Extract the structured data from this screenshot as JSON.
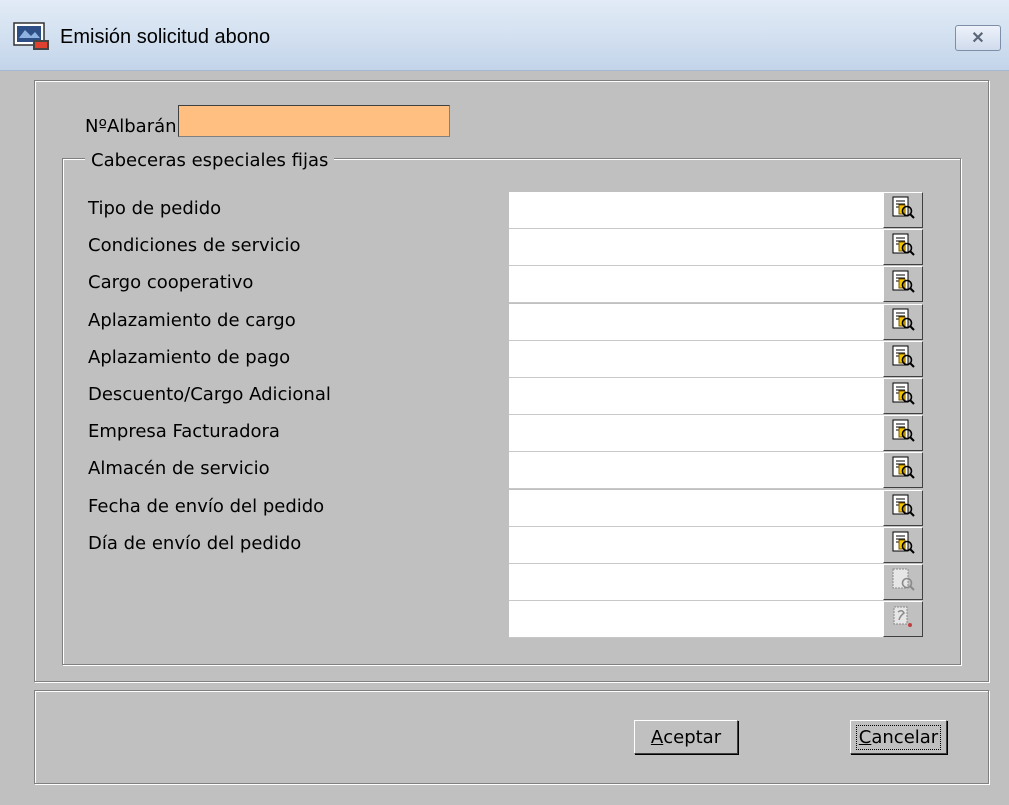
{
  "window": {
    "title": "Emisión solicitud abono",
    "close_glyph": "✕"
  },
  "albaran": {
    "label": "NºAlbarán",
    "value": "",
    "highlight_color": "#ffbf80"
  },
  "group": {
    "title": "Cabeceras especiales fijas",
    "rows": [
      {
        "label": "Tipo de pedido",
        "value": ""
      },
      {
        "label": "Condiciones de servicio",
        "value": ""
      },
      {
        "label": "Cargo cooperativo",
        "value": ""
      },
      {
        "label": "Aplazamiento de cargo",
        "value": ""
      },
      {
        "label": "Aplazamiento de pago",
        "value": ""
      },
      {
        "label": "Descuento/Cargo Adicional",
        "value": ""
      },
      {
        "label": "Empresa Facturadora",
        "value": ""
      },
      {
        "label": "Almacén de servicio",
        "value": ""
      },
      {
        "label": "Fecha de envío del pedido",
        "value": ""
      },
      {
        "label": "Día de envío del pedido",
        "value": ""
      },
      {
        "label": "",
        "value": ""
      },
      {
        "label": "",
        "value": ""
      }
    ]
  },
  "buttons": {
    "accept_key": "A",
    "accept_rest": "ceptar",
    "cancel_key": "C",
    "cancel_rest": "ancelar"
  }
}
